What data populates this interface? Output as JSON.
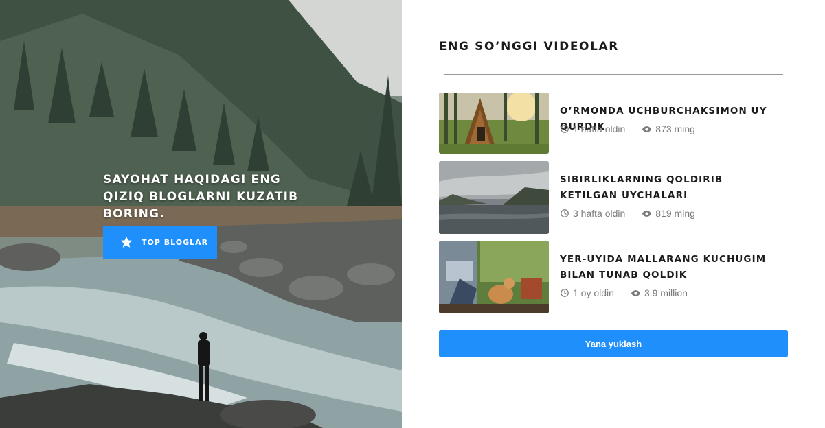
{
  "hero": {
    "headline": "SAYOHAT HAQIDAGI ENG QIZIQ BLOGLARNI KUZATIB BORING.",
    "button_label": "TOP BLOGLAR",
    "button_icon": "star-icon",
    "accent_color": "#1e8ffb"
  },
  "videos_section": {
    "title": "ENG SO’NGGI VIDEOLAR",
    "items": [
      {
        "title": "O’RMONDA UCHBURCHAKSIMON UY QURDIK",
        "time": "1 hafta oldin",
        "views": "873 ming"
      },
      {
        "title": "SIBIRLIKLARNING QOLDIRIB KETILGAN UYCHALARI",
        "time": "3 hafta oldin",
        "views": "819 ming"
      },
      {
        "title": "YER-UYIDA MALLARANG KUCHUGIM BILAN TUNAB QOLDIK",
        "time": "1 oy oldin",
        "views": "3.9 million"
      }
    ],
    "load_more_label": "Yana yuklash"
  },
  "icons": {
    "time": "clock-icon",
    "views": "eye-icon"
  }
}
